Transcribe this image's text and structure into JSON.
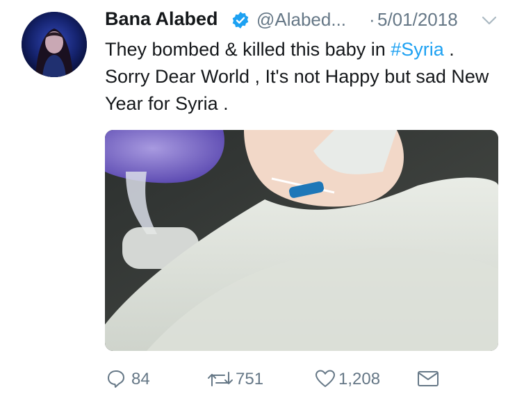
{
  "tweet": {
    "display_name": "Bana Alabed",
    "handle": "@Alabed...",
    "separator": "·",
    "date": "5/01/2018",
    "text_before_hashtag": "They bombed & killed this baby in",
    "hashtag": "#Syria",
    "text_after_hashtag": ". Sorry Dear World , It's not Happy but sad New Year for Syria .",
    "accent_color": "#1da1f2",
    "muted_color": "#657786"
  },
  "actions": {
    "replies": "84",
    "retweets": "751",
    "likes": "1,208"
  },
  "icons": {
    "avatar": "profile-photo",
    "verified": "verified-badge-icon",
    "menu": "chevron-down-icon",
    "reply": "reply-icon",
    "retweet": "retweet-icon",
    "like": "heart-icon",
    "dm": "envelope-icon"
  }
}
